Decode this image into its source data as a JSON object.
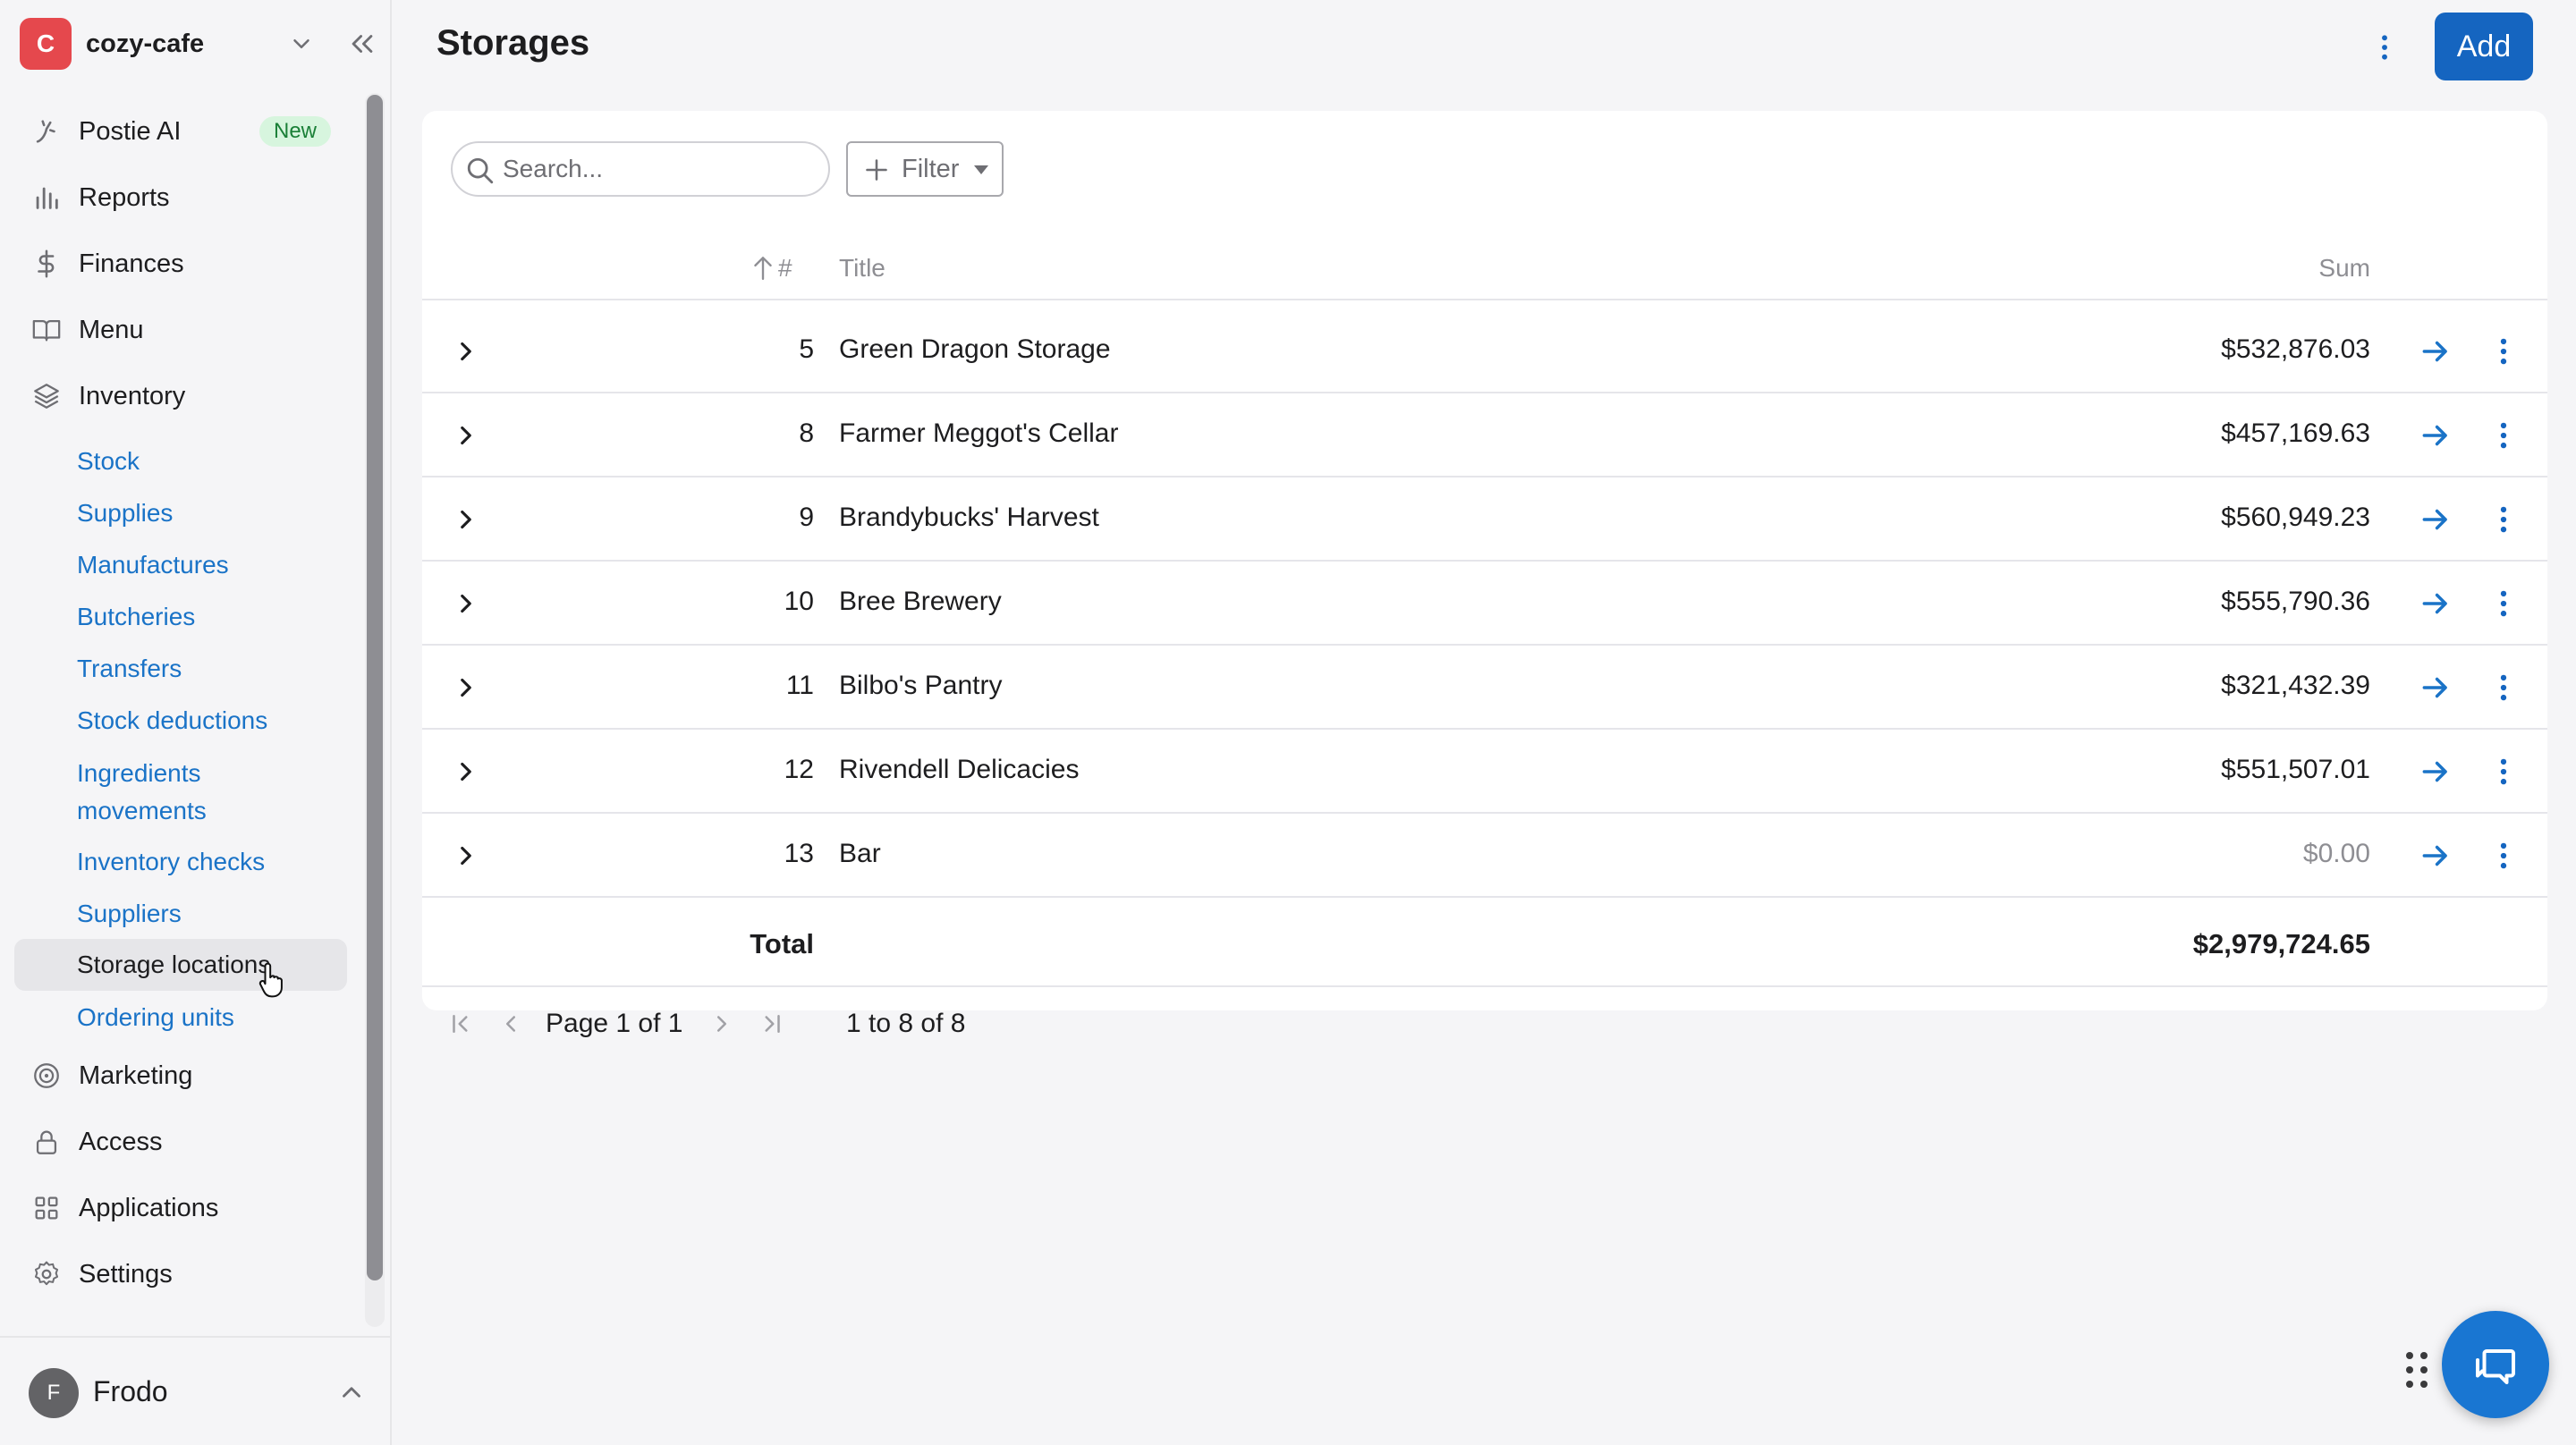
{
  "org": {
    "initial": "C",
    "name": "cozy-cafe"
  },
  "nav": {
    "postie_ai": "Postie AI",
    "postie_badge": "New",
    "reports": "Reports",
    "finances": "Finances",
    "menu": "Menu",
    "inventory": "Inventory",
    "inventory_items": [
      "Stock",
      "Supplies",
      "Manufactures",
      "Butcheries",
      "Transfers",
      "Stock deductions",
      "Ingredients movements",
      "Inventory checks",
      "Suppliers",
      "Storage locations",
      "Ordering units"
    ],
    "active_item": "Storage locations",
    "marketing": "Marketing",
    "access": "Access",
    "applications": "Applications",
    "settings": "Settings"
  },
  "user": {
    "initial": "F",
    "name": "Frodo"
  },
  "page": {
    "title": "Storages",
    "add_label": "Add"
  },
  "toolbar": {
    "search_placeholder": "Search...",
    "filter_label": "Filter"
  },
  "table": {
    "columns": {
      "num": "#",
      "title": "Title",
      "sum": "Sum"
    },
    "rows": [
      {
        "num": "5",
        "title": "Green Dragon Storage",
        "sum": "$532,876.03"
      },
      {
        "num": "8",
        "title": "Farmer Meggot's Cellar",
        "sum": "$457,169.63"
      },
      {
        "num": "9",
        "title": "Brandybucks' Harvest",
        "sum": "$560,949.23"
      },
      {
        "num": "10",
        "title": "Bree Brewery",
        "sum": "$555,790.36"
      },
      {
        "num": "11",
        "title": "Bilbo's Pantry",
        "sum": "$321,432.39"
      },
      {
        "num": "12",
        "title": "Rivendell Delicacies",
        "sum": "$551,507.01"
      },
      {
        "num": "13",
        "title": "Bar",
        "sum": "$0.00"
      }
    ],
    "total_label": "Total",
    "total_sum": "$2,979,724.65"
  },
  "pagination": {
    "page_text": "Page 1 of 1",
    "range_text": "1 to 8 of 8"
  },
  "colors": {
    "accent": "#1565c0",
    "link": "#1a73c7",
    "org_avatar": "#e5484d",
    "badge_bg": "#d7f5de"
  }
}
